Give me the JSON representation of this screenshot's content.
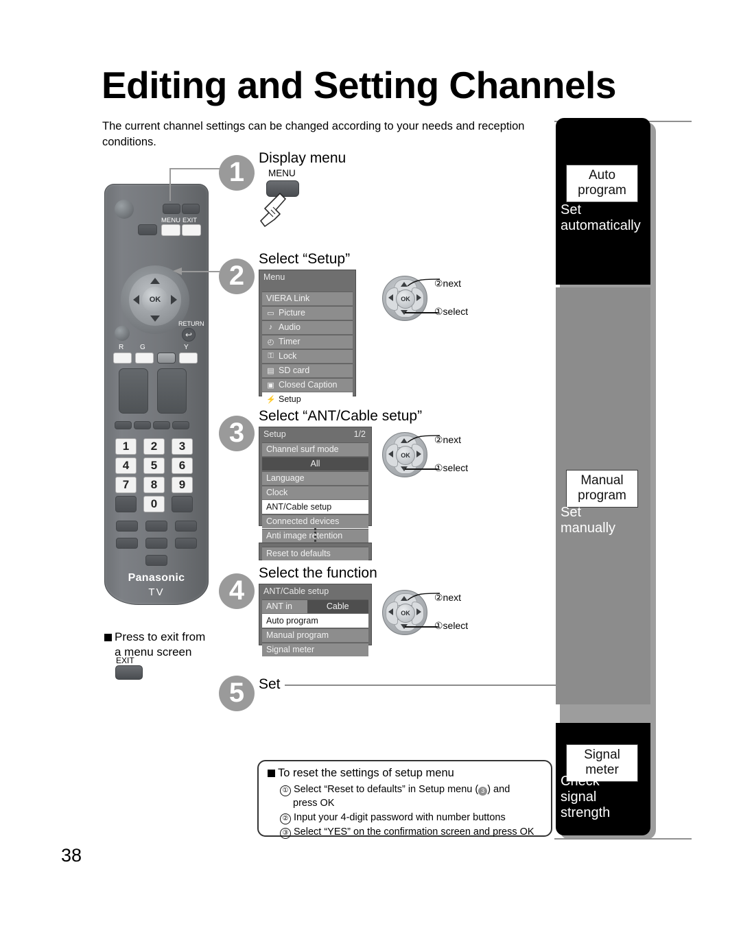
{
  "page": {
    "title": "Editing and Setting Channels",
    "intro": "The current channel settings can be changed according to your needs and reception conditions.",
    "page_number": "38"
  },
  "steps": [
    {
      "num": "1",
      "heading": "Display menu",
      "button_label": "MENU"
    },
    {
      "num": "2",
      "heading": "Select “Setup”"
    },
    {
      "num": "3",
      "heading": "Select “ANT/Cable setup”"
    },
    {
      "num": "4",
      "heading": "Select the function"
    },
    {
      "num": "5",
      "heading": "Set"
    }
  ],
  "remote": {
    "menu_label": "MENU",
    "exit_label": "EXIT",
    "ok_label": "OK",
    "return_label": "RETURN",
    "return_icon": "↩",
    "color_buttons": [
      "R",
      "G",
      "Y"
    ],
    "numbers": [
      "1",
      "2",
      "3",
      "4",
      "5",
      "6",
      "7",
      "8",
      "9",
      "0"
    ],
    "brand": "Panasonic",
    "device": "TV"
  },
  "menu_screen": {
    "title": "Menu",
    "items": [
      {
        "icon": "",
        "label": "VIERA Link",
        "selected": false
      },
      {
        "icon": "▭",
        "label": "Picture",
        "selected": false
      },
      {
        "icon": "♪",
        "label": "Audio",
        "selected": false
      },
      {
        "icon": "◴",
        "label": "Timer",
        "selected": false
      },
      {
        "icon": "⚿",
        "label": "Lock",
        "selected": false
      },
      {
        "icon": "▤",
        "label": "SD card",
        "selected": false
      },
      {
        "icon": "▣",
        "label": "Closed Caption",
        "selected": false
      },
      {
        "icon": "⚡",
        "label": "Setup",
        "selected": true
      }
    ]
  },
  "setup_screen": {
    "title": "Setup",
    "page_count": "1/2",
    "items": [
      {
        "label": "Channel surf mode",
        "selected": false,
        "type": "row"
      },
      {
        "label": "All",
        "selected": false,
        "type": "value"
      },
      {
        "label": "Language",
        "selected": false,
        "type": "row"
      },
      {
        "label": "Clock",
        "selected": false,
        "type": "row"
      },
      {
        "label": "ANT/Cable setup",
        "selected": true,
        "type": "row"
      },
      {
        "label": "Connected devices",
        "selected": false,
        "type": "row"
      },
      {
        "label": "Anti image retention",
        "selected": false,
        "type": "row"
      }
    ],
    "more_caret": "▼",
    "reset_item": "Reset to defaults"
  },
  "ant_cable_screen": {
    "title": "ANT/Cable setup",
    "ant_in_label": "ANT in",
    "ant_in_value": "Cable",
    "items": [
      {
        "label": "Auto program",
        "selected": true
      },
      {
        "label": "Manual program",
        "selected": false
      },
      {
        "label": "Signal meter",
        "selected": false
      }
    ]
  },
  "dpad_callouts": {
    "next": "②next",
    "select": "①select",
    "ok_label": "OK"
  },
  "exit_note": {
    "line1": "Press to exit from",
    "line2": "a menu screen",
    "button_label": "EXIT"
  },
  "sidebar": [
    {
      "label": "Auto\nprogram",
      "label_line1": "Auto",
      "label_line2": "program",
      "description_line1": "Set",
      "description_line2": "automatically",
      "theme": "black"
    },
    {
      "label_line1": "Manual",
      "label_line2": "program",
      "description_line1": "Set",
      "description_line2": "manually",
      "theme": "gray"
    },
    {
      "label_line1": "Signal",
      "label_line2": "meter",
      "description_line1": "Check",
      "description_line2": "signal",
      "description_line3": "strength",
      "theme": "black"
    }
  ],
  "reset_note": {
    "title": "To reset the settings of setup menu",
    "lines": [
      {
        "num": "①",
        "text_before": "Select “Reset to defaults” in Setup menu (",
        "badge": "3",
        "text_after": ") and"
      },
      {
        "num": "",
        "text_before": "press OK",
        "badge": "",
        "text_after": ""
      },
      {
        "num": "②",
        "text_before": "Input your 4-digit password with number buttons",
        "badge": "",
        "text_after": ""
      },
      {
        "num": "③",
        "text_before": "Select “YES” on the confirmation screen and press OK",
        "badge": "",
        "text_after": ""
      }
    ]
  },
  "colors": {
    "gray_panel": "#8c8c8c",
    "black_panel": "#000000",
    "step_circle": "#9a9a9a",
    "osd_bg": "#6f6f6f",
    "osd_row": "#8d8d8d",
    "osd_dark": "#4e4e4e"
  }
}
